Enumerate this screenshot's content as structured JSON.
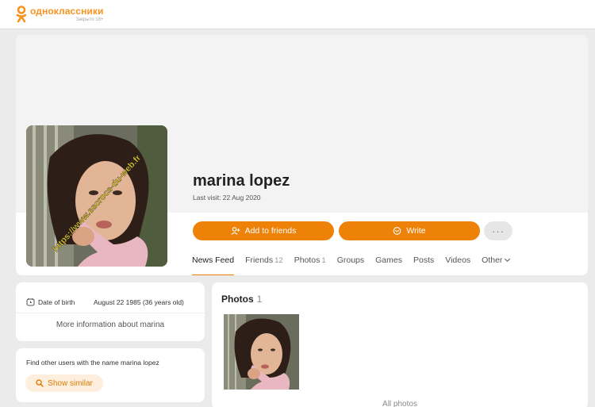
{
  "header": {
    "logo_name": "одноклассники",
    "logo_sub": "Закрыто 18+",
    "logo_badge": "",
    "accent": "#ee8208"
  },
  "profile": {
    "name": "marina lopez",
    "last_visit": "Last visit: 22 Aug 2020",
    "watermark": "https://www.escrocs-du-web.fr",
    "buttons": {
      "add_friends": "Add to friends",
      "write": "Write",
      "more": "···"
    },
    "tabs": [
      {
        "label": "News Feed",
        "count": ""
      },
      {
        "label": "Friends",
        "count": "12"
      },
      {
        "label": "Photos",
        "count": "1"
      },
      {
        "label": "Groups",
        "count": ""
      },
      {
        "label": "Games",
        "count": ""
      },
      {
        "label": "Posts",
        "count": ""
      },
      {
        "label": "Videos",
        "count": ""
      },
      {
        "label": "Other",
        "count": ""
      }
    ]
  },
  "info": {
    "dob_label": "Date of birth",
    "dob_value": "August 22 1985 (36 years old)",
    "more_info": "More information about marina"
  },
  "similar": {
    "text": "Find other users with the name marina lopez",
    "button": "Show similar"
  },
  "photos": {
    "title": "Photos",
    "count": "1",
    "all_photos": "All photos"
  }
}
